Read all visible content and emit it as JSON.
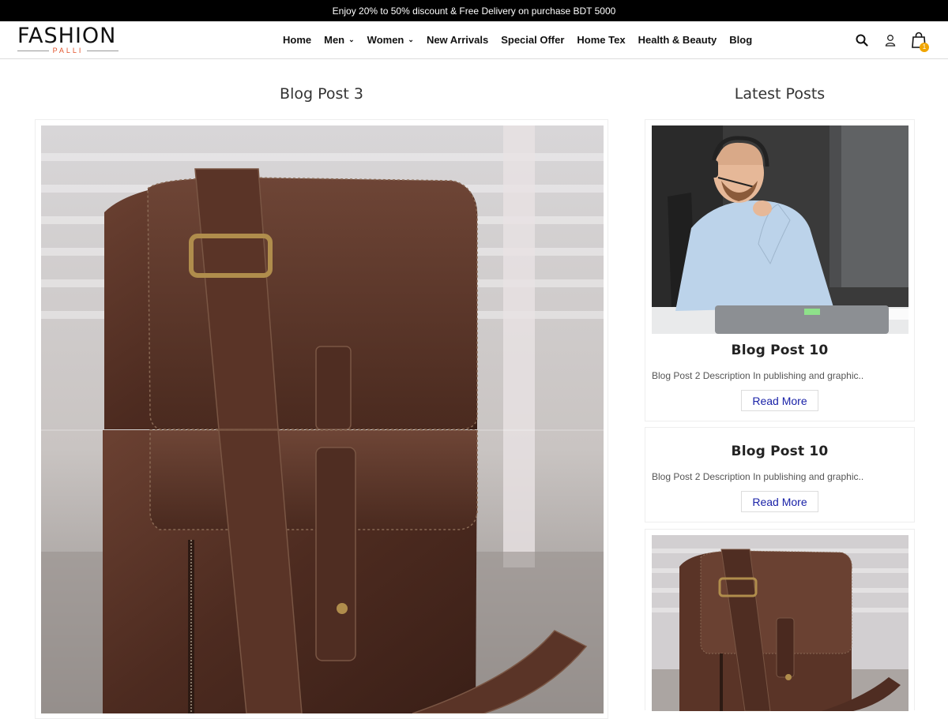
{
  "announcement": "Enjoy 20% to 50% discount & Free Delivery on purchase BDT 5000",
  "logo": {
    "main": "FASHION",
    "sub": "PALLI"
  },
  "nav": {
    "items": [
      {
        "label": "Home"
      },
      {
        "label": "Men"
      },
      {
        "label": "Women"
      },
      {
        "label": "New Arrivals"
      },
      {
        "label": "Special Offer"
      },
      {
        "label": "Home Tex"
      },
      {
        "label": "Health & Beauty"
      },
      {
        "label": "Blog"
      }
    ],
    "cart_count": "1",
    "icons": [
      "search-icon",
      "user-icon",
      "cart-icon"
    ]
  },
  "main": {
    "title": "Blog Post 3"
  },
  "sidebar": {
    "title": "Latest Posts",
    "posts": [
      {
        "title": "Blog Post 10",
        "description": "Blog Post 2 Description In publishing and graphic..",
        "button": "Read More"
      },
      {
        "title": "Blog Post 10",
        "description": "Blog Post 2 Description In publishing and graphic..",
        "button": "Read More"
      }
    ]
  },
  "colors": {
    "topbar": "#000000",
    "link": "#1a22a8",
    "logo_accent": "#e2542c",
    "badge": "#f0a500"
  }
}
